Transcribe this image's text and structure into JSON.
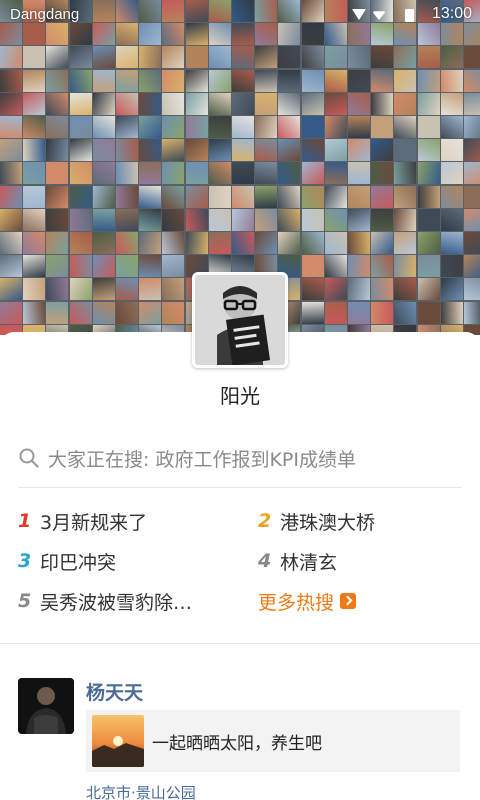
{
  "status_bar": {
    "carrier": "Dangdang",
    "time": "13:00"
  },
  "profile": {
    "name": "阳光"
  },
  "search": {
    "placeholder": "大家正在搜: 政府工作报到KPI成绩单"
  },
  "hot_topics": [
    {
      "rank": "1",
      "title": "3月新规来了",
      "color": "#e23a2a"
    },
    {
      "rank": "2",
      "title": "港珠澳大桥",
      "color": "#f0a020"
    },
    {
      "rank": "3",
      "title": "印巴冲突",
      "color": "#2aa6c9"
    },
    {
      "rank": "4",
      "title": "林清玄",
      "color": "#888888"
    },
    {
      "rank": "5",
      "title": "吴秀波被雪豹除…",
      "color": "#888888"
    }
  ],
  "more_hot": {
    "label": "更多热搜"
  },
  "feed": {
    "author": "杨天天",
    "quote_text": "一起晒晒太阳，养生吧",
    "location": "北京市·景山公园"
  },
  "colors": {
    "accent_orange": "#f07a16",
    "link_blue": "#4a6a98"
  }
}
